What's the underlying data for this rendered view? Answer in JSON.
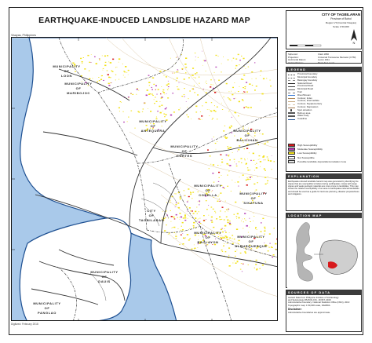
{
  "title": "EARTHQUAKE-INDUCED LANDSLIDE HAZARD MAP",
  "subregion": "Visayas, Philippines",
  "footnote": "Digitized: February 2018",
  "city_block": {
    "name": "CITY OF TAGBILARAN",
    "province": "Province of Bohol",
    "region": "Region VII (Central Visayas)",
    "sheet": "Scale 1:50,000"
  },
  "specs": [
    {
      "label": "Spheroid:",
      "value": "Clark 1866"
    },
    {
      "label": "Projection:",
      "value": "Universal Transverse Mercator (UTM)"
    },
    {
      "label": "Horizontal Datum:",
      "value": "Luzon 1911"
    },
    {
      "label": "Vertical Datum:",
      "value": "Mean Sea Level"
    }
  ],
  "legend": {
    "heading": "LEGEND",
    "items": [
      {
        "label": "Provincial boundary",
        "color": "#333333",
        "style": "dashdot"
      },
      {
        "label": "Municipal boundary",
        "color": "#555555",
        "style": "dashdot"
      },
      {
        "label": "Barangay boundary",
        "color": "#888888",
        "style": "dash"
      },
      {
        "label": "National Road",
        "color": "#222222",
        "style": "solid"
      },
      {
        "label": "Provincial Road",
        "color": "#444444",
        "style": "solid"
      },
      {
        "label": "Municipal Road",
        "color": "#666666",
        "style": "solid"
      },
      {
        "label": "Trail",
        "color": "#777777",
        "style": "dash"
      },
      {
        "label": "River/Stream",
        "color": "#3a7bd5",
        "style": "solid"
      },
      {
        "label": "Contour, Index",
        "color": "#b08a5a",
        "style": "solid"
      },
      {
        "label": "Contour, Intermediate",
        "color": "#c9ad86",
        "style": "solid"
      },
      {
        "label": "Contour, Supplementary",
        "color": "#d8c4a6",
        "style": "dash"
      },
      {
        "label": "Contour, Depression",
        "color": "#a67c52",
        "style": "solid"
      },
      {
        "label": "Spot elevation",
        "color": "#333333",
        "style": "dot"
      },
      {
        "label": "Built-up area",
        "color": "#b0b0b0",
        "style": "fill"
      },
      {
        "label": "Water body",
        "color": "#a9c9ea",
        "style": "fill"
      },
      {
        "label": "Coastline",
        "color": "#1d4f91",
        "style": "solid"
      }
    ]
  },
  "hazard": {
    "items": [
      {
        "label": "High Susceptibility",
        "color": "#d7191c"
      },
      {
        "label": "Moderate Susceptibility",
        "color": "#b43fb3"
      },
      {
        "label": "Low Susceptibility",
        "color": "#f2e11a"
      },
      {
        "label": "Not Susceptible",
        "color": "#ffffff"
      },
      {
        "label": "Possible landslide deposit/accumulation zone",
        "color": "#e6e6e6"
      }
    ]
  },
  "explanation": {
    "heading": "EXPLANATION",
    "text": "Earthquake-induced landslide hazard map was generated by identifying the slopes that are susceptible to failure during earthquakes. Areas with steep slopes and weak geologic materials are more prone to landslides. This map shows the relative susceptibility of an area to earthquake-induced landslides and should be used as a guide for land-use planning, disaster preparedness and mitigation."
  },
  "location": {
    "heading": "LOCATION MAP"
  },
  "sources": {
    "heading": "SOURCES OF DATA",
    "lines": [
      "Hazard Data from Philippine Institute of Volcanology",
      "and Seismology (PHIVOLCS) - DOST, 2018",
      "Administrative boundary: National Statistics Office (NSO), 2010",
      "Topographic map: 1:50,000 scale, NAMRIA"
    ],
    "disclaimer_heading": "Disclaimer:",
    "disclaimer_text": "Administrative boundaries are approximate."
  },
  "map_labels": {
    "loon": [
      "MUNICIPALITY",
      "OF",
      "LOON"
    ],
    "maribojoc": [
      "MUNICIPALITY",
      "OF",
      "MARIBOJOC"
    ],
    "antequera": [
      "MUNICIPALITY",
      "OF",
      "ANTEQUERA"
    ],
    "cortes": [
      "MUNICIPALITY",
      "OF",
      "CORTES"
    ],
    "balilihan": [
      "MUNICIPALITY",
      "OF",
      "BALILIHAN"
    ],
    "corella": [
      "MUNICIPALITY",
      "OF",
      "CORELLA"
    ],
    "sikatuna": [
      "MUNICIPALITY",
      "OF",
      "SIKATUNA"
    ],
    "tagbilaran": [
      "CITY",
      "OF",
      "TAGBILARAN"
    ],
    "baclayon": [
      "MUNICIPALITY",
      "OF",
      "BACLAYON"
    ],
    "albuquerque": [
      "MUNICIPALITY",
      "OF",
      "ALBURQUERQUE"
    ],
    "dauis": [
      "MUNICIPALITY",
      "OF",
      "DAUIS"
    ],
    "panglao": [
      "MUNICIPALITY",
      "OF",
      "PANGLAO"
    ]
  },
  "colors": {
    "sea": "#a9c9ea",
    "land": "#ffffff",
    "coast": "#1d4f91",
    "boundary": "#444444",
    "road": "#555555",
    "low": "#f2e11a",
    "moderate": "#b43fb3",
    "high": "#d7191c",
    "contour": "#d8c2a0",
    "panel_header": "#3b3b3b"
  }
}
